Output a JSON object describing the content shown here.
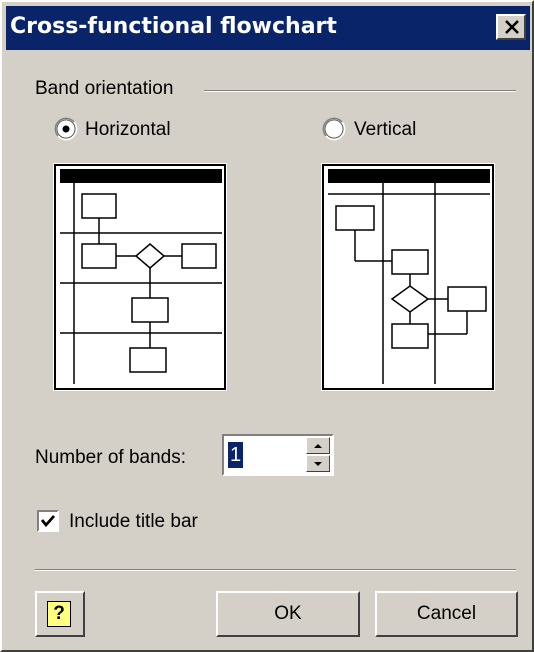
{
  "window": {
    "title": "Cross-functional flowchart"
  },
  "band_orientation": {
    "group_label": "Band orientation",
    "options": [
      {
        "label": "Horizontal",
        "selected": true
      },
      {
        "label": "Vertical",
        "selected": false
      }
    ]
  },
  "number_of_bands": {
    "label": "Number of bands:",
    "value": "1"
  },
  "include_title_bar": {
    "label": "Include title bar",
    "checked": true
  },
  "buttons": {
    "help": "?",
    "ok": "OK",
    "cancel": "Cancel"
  },
  "colors": {
    "titlebar": "#0a246a",
    "face": "#d4d0c8"
  }
}
